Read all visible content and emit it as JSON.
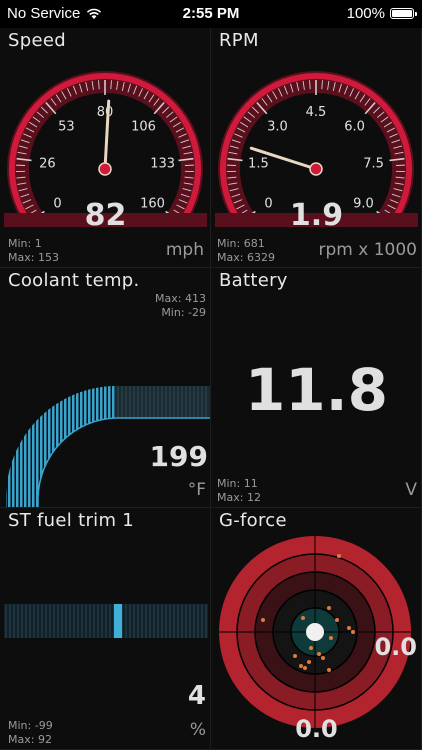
{
  "status": {
    "carrier": "No Service",
    "time": "2:55 PM",
    "battery": "100%"
  },
  "speed": {
    "title": "Speed",
    "value": "82",
    "needle_value": 82,
    "max_scale": 160,
    "ticks": [
      "0",
      "26",
      "53",
      "80",
      "106",
      "133",
      "160"
    ],
    "min_label": "Min: 1",
    "max_label": "Max: 153",
    "unit": "mph"
  },
  "rpm": {
    "title": "RPM",
    "value": "1.9",
    "needle_value": 1.9,
    "max_scale": 9,
    "ticks": [
      "0",
      "1.5",
      "3.0",
      "4.5",
      "6.0",
      "7.5",
      "9.0"
    ],
    "min_label": "Min: 681",
    "max_label": "Max: 6329",
    "unit": "rpm x 1000"
  },
  "coolant": {
    "title": "Coolant temp.",
    "value": "199",
    "max_label": "Max: 413",
    "min_label": "Min: -29",
    "unit": "°F"
  },
  "battery": {
    "title": "Battery",
    "value": "11.8",
    "min_label": "Min: 11",
    "max_label": "Max: 12",
    "unit": "V"
  },
  "fuel": {
    "title": "ST fuel trim 1",
    "value": "4",
    "min_label": "Min: -99",
    "max_label": "Max: 92",
    "unit": "%"
  },
  "gforce": {
    "title": "G-force",
    "x_value": "0.0",
    "y_value": "0.0"
  },
  "colors": {
    "accent_red": "#d01a3c",
    "needle": "#e8d8c0",
    "cyan": "#3fb0d8"
  },
  "icons": [
    "wifi-icon",
    "battery-icon"
  ]
}
